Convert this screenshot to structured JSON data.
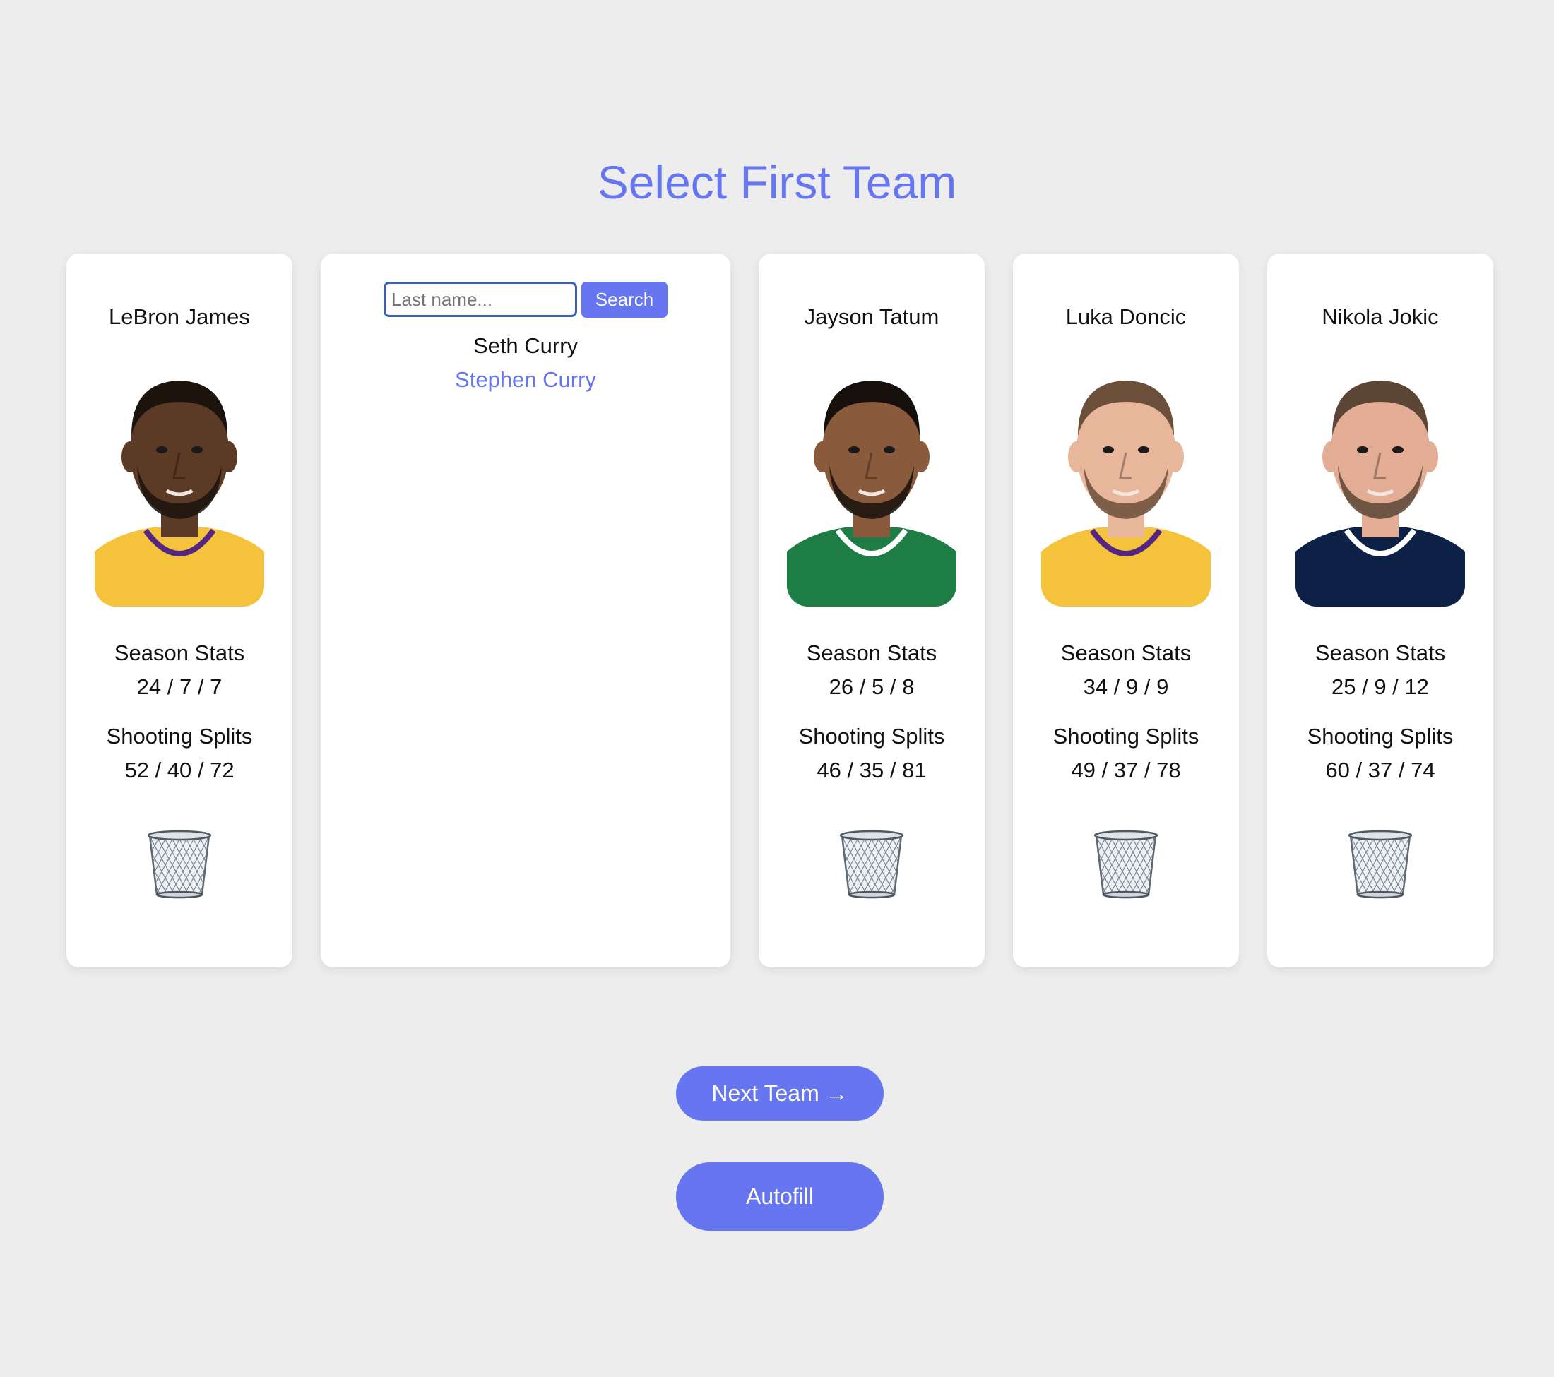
{
  "page": {
    "title": "Select First Team",
    "accent_color": "#6675f0",
    "background_color": "#ededed"
  },
  "players": [
    {
      "name": "LeBron James",
      "season_stats_label": "Season Stats",
      "season_stats": "24 / 7 / 7",
      "shooting_splits_label": "Shooting Splits",
      "shooting_splits": "52 / 40 / 72",
      "jersey_color": "#f5c33b",
      "trim_color": "#552583",
      "skin_color": "#5b3a26",
      "hair_color": "#1c130d",
      "remove_icon": "trash-icon"
    },
    {
      "name": "Jayson Tatum",
      "season_stats_label": "Season Stats",
      "season_stats": "26 / 5 / 8",
      "shooting_splits_label": "Shooting Splits",
      "shooting_splits": "46 / 35 / 81",
      "jersey_color": "#1e7d45",
      "trim_color": "#ffffff",
      "skin_color": "#8a5a3c",
      "hair_color": "#15100c",
      "remove_icon": "trash-icon"
    },
    {
      "name": "Luka Doncic",
      "season_stats_label": "Season Stats",
      "season_stats": "34 / 9 / 9",
      "shooting_splits_label": "Shooting Splits",
      "shooting_splits": "49 / 37 / 78",
      "jersey_color": "#f5c33b",
      "trim_color": "#552583",
      "skin_color": "#e8b79b",
      "hair_color": "#6b4f3a",
      "remove_icon": "trash-icon"
    },
    {
      "name": "Nikola Jokic",
      "season_stats_label": "Season Stats",
      "season_stats": "25 / 9 / 12",
      "shooting_splits_label": "Shooting Splits",
      "shooting_splits": "60 / 37 / 74",
      "jersey_color": "#0d2146",
      "trim_color": "#ffffff",
      "skin_color": "#e2ad94",
      "hair_color": "#5b4636",
      "remove_icon": "trash-icon"
    }
  ],
  "search": {
    "placeholder": "Last name...",
    "value": "",
    "button_label": "Search",
    "results": [
      "Seth Curry",
      "Stephen Curry"
    ]
  },
  "actions": {
    "next_team_label": "Next Team →",
    "autofill_label": "Autofill"
  }
}
